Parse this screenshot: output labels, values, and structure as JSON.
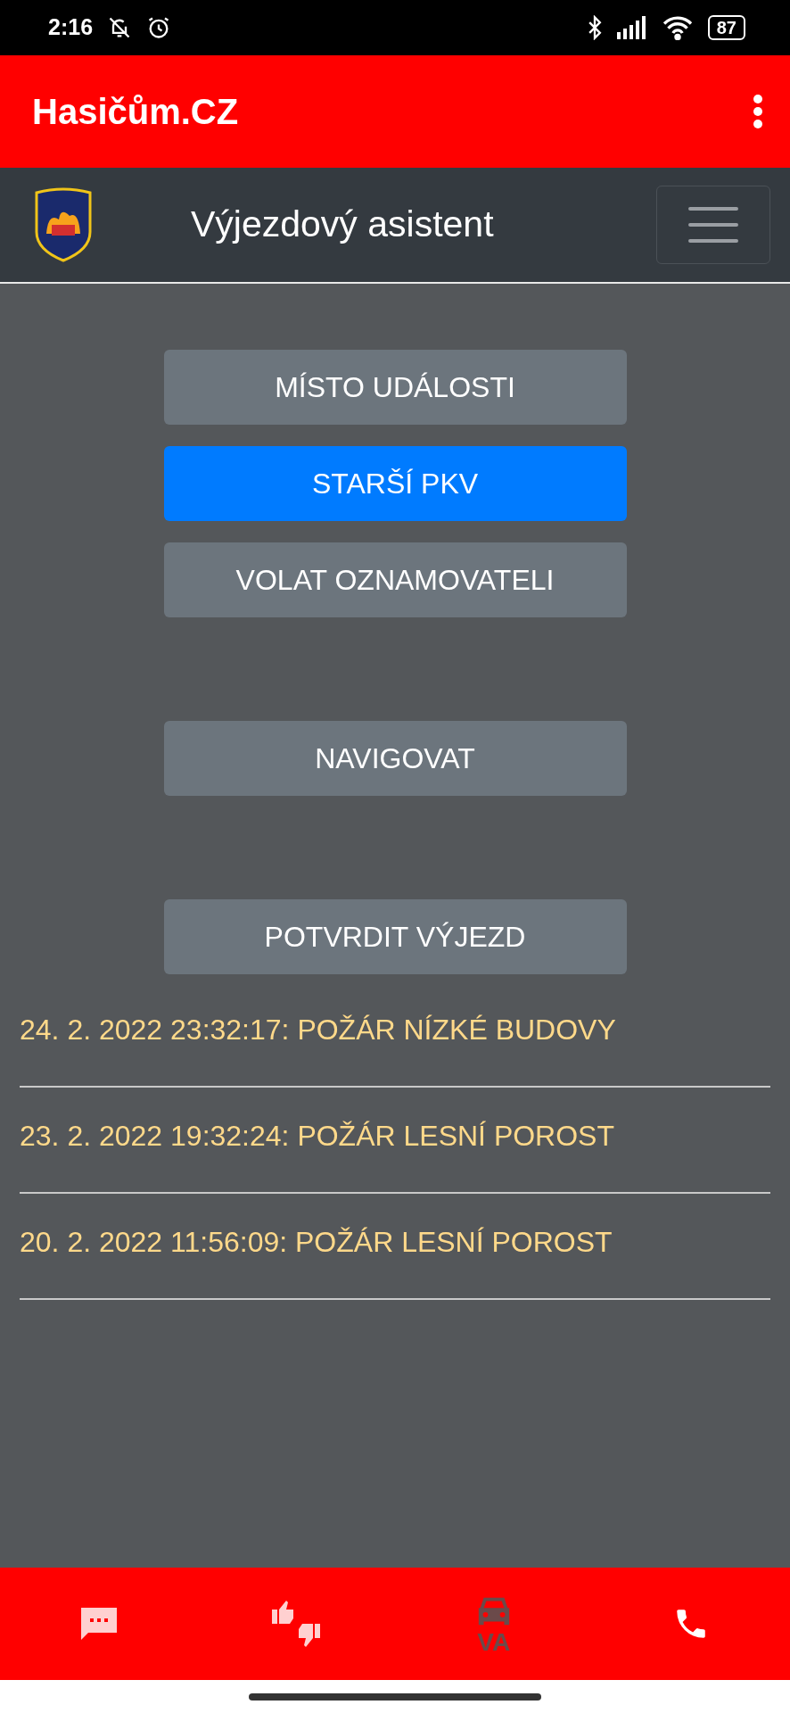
{
  "status_bar": {
    "time": "2:16",
    "battery": "87"
  },
  "app_bar": {
    "title": "Hasičům.CZ"
  },
  "navbar": {
    "title": "Výjezdový asistent"
  },
  "button_groups": [
    [
      {
        "label": "MÍSTO UDÁLOSTI",
        "selected": false
      },
      {
        "label": "STARŠÍ PKV",
        "selected": true
      },
      {
        "label": "VOLAT OZNAMOVATELI",
        "selected": false
      }
    ],
    [
      {
        "label": "NAVIGOVAT",
        "selected": false
      }
    ],
    [
      {
        "label": "POTVRDIT VÝJEZD",
        "selected": false
      }
    ]
  ],
  "events": [
    {
      "text": "24. 2. 2022 23:32:17: POŽÁR NÍZKÉ BUDOVY"
    },
    {
      "text": "23. 2. 2022 19:32:24: POŽÁR LESNÍ POROST"
    },
    {
      "text": "20. 2. 2022 11:56:09: POŽÁR LESNÍ POROST"
    }
  ],
  "bottom_nav": [
    {
      "kind": "chat",
      "selected": false
    },
    {
      "kind": "thumbs",
      "selected": false
    },
    {
      "kind": "car",
      "label": "VA",
      "selected": true
    },
    {
      "kind": "phone",
      "selected": false
    }
  ]
}
